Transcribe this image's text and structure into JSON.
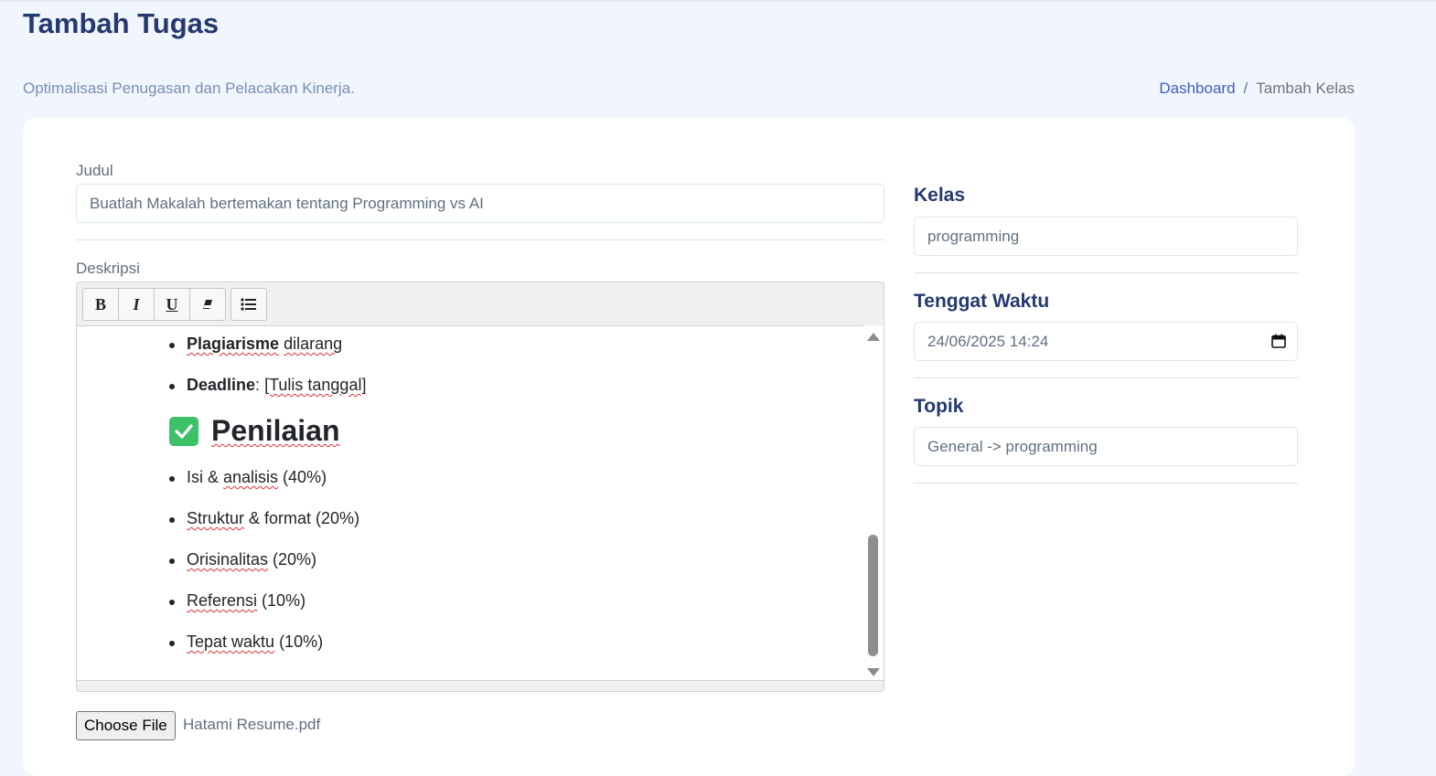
{
  "header": {
    "title": "Tambah Tugas",
    "subtitle": "Optimalisasi Penugasan dan Pelacakan Kinerja.",
    "breadcrumb": {
      "link": "Dashboard",
      "separator": "/",
      "current": "Tambah Kelas"
    }
  },
  "form": {
    "judul": {
      "label": "Judul",
      "value": "Buatlah Makalah bertemakan tentang Programming vs AI"
    },
    "deskripsi": {
      "label": "Deskripsi",
      "toolbar": {
        "bold": "B",
        "italic": "I",
        "underline": "U"
      },
      "content": {
        "bullet1_bold": "Plagiarisme",
        "bullet1_rest": "dilarang",
        "bullet2_bold": "Deadline",
        "bullet2_colon": ":",
        "bullet2_rest": "[Tulis tanggal]",
        "heading": "Penilaian",
        "items": [
          {
            "a": "Isi & ",
            "b": "analisis",
            "c": " (40%)"
          },
          {
            "a": "",
            "b": "Struktur",
            "c": " & format (20%)"
          },
          {
            "a": "",
            "b": "Orisinalitas",
            "c": " (20%)"
          },
          {
            "a": "",
            "b": "Referensi",
            "c": " (10%)"
          },
          {
            "a": "",
            "b": "Tepat waktu",
            "c": " (10%)"
          }
        ]
      }
    },
    "file": {
      "button": "Choose File",
      "name": "Hatami Resume.pdf"
    }
  },
  "sidebar": {
    "kelas": {
      "label": "Kelas",
      "value": "programming"
    },
    "tenggat": {
      "label": "Tenggat Waktu",
      "value": "24/06/2025 14:24"
    },
    "topik": {
      "label": "Topik",
      "value": "General -> programming"
    }
  },
  "colors": {
    "background": "#f1f6fe",
    "heading": "#25396f",
    "link": "#435ebe",
    "check": "#3cc068"
  }
}
